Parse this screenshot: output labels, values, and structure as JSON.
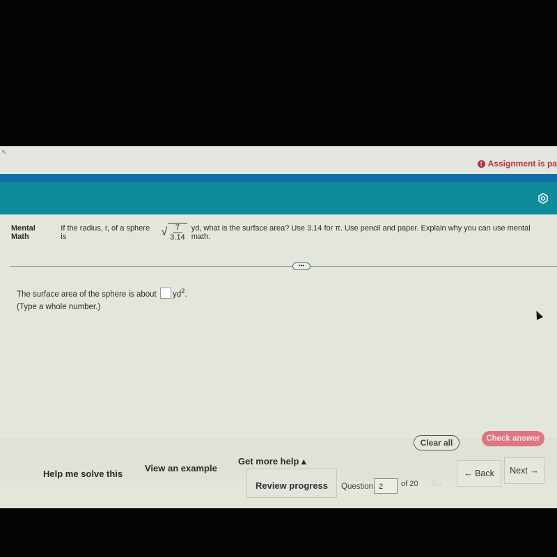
{
  "header": {
    "assignment_status": "Assignment is pa",
    "alert_icon": "!"
  },
  "question": {
    "label": "Mental Math",
    "text_before": "If the radius, r, of a sphere is",
    "numerator": "7",
    "denominator": "3.14",
    "text_after": "yd, what is the surface area? Use 3.14 for π. Use pencil and paper. Explain why you can use mental math."
  },
  "expand_dots": "•••",
  "answer": {
    "prefix": "The surface area of the sphere is about",
    "unit": "yd",
    "unit_exp": "2",
    "suffix": ".",
    "value": "",
    "hint": "(Type a whole number.)"
  },
  "help": {
    "solve": "Help me solve this",
    "example": "View an example",
    "more": "Get more help ▴"
  },
  "actions": {
    "clear_all": "Clear all",
    "check_answer": "Check answer"
  },
  "nav": {
    "review": "Review progress",
    "question_label": "Question",
    "question_number": "2",
    "of_total": "of 20",
    "go": "Go",
    "back": "← Back",
    "next": "Next →"
  },
  "colors": {
    "teal": "#108b9b",
    "blue": "#0f6fa6",
    "alert_red": "#b7303e",
    "check_pink": "#dc7680"
  }
}
